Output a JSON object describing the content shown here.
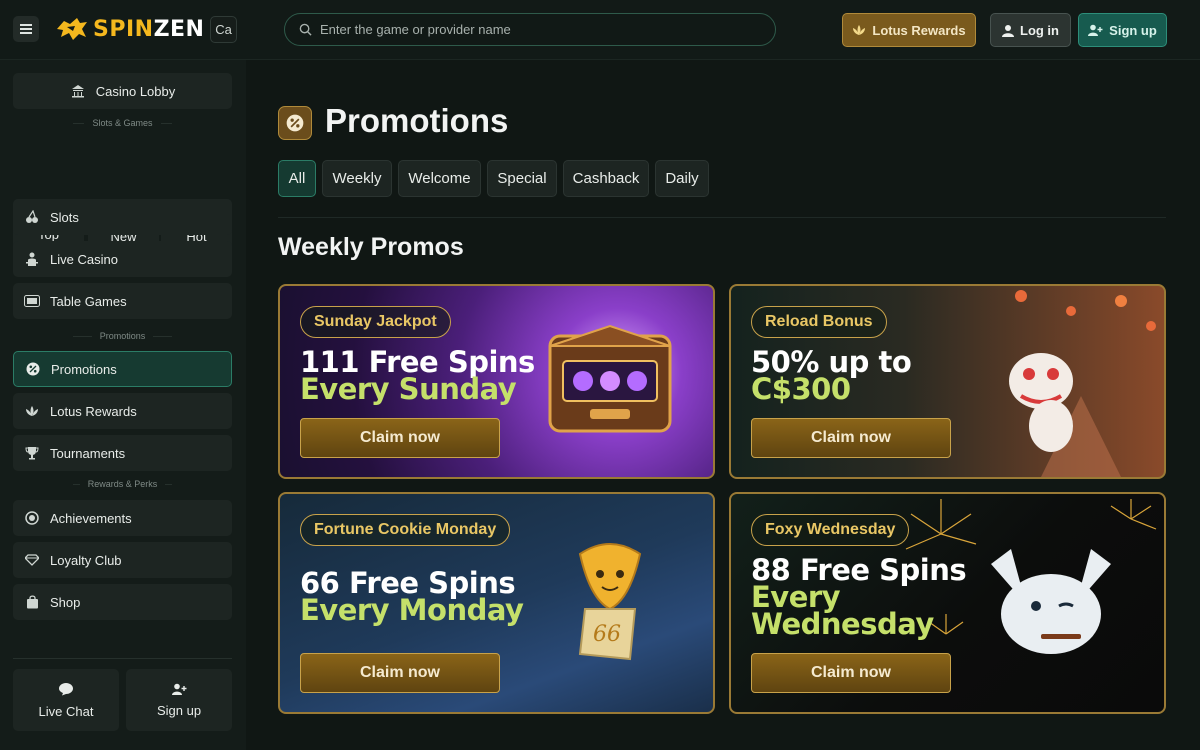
{
  "header": {
    "brand": {
      "part1": "SPIN",
      "part2": "ZEN"
    },
    "lang": "Ca",
    "search_placeholder": "Enter the game or provider name",
    "rewards_label": "Lotus Rewards",
    "login_label": "Log in",
    "signup_label": "Sign up"
  },
  "sidebar": {
    "lobby": "Casino Lobby",
    "sep1": "Slots & Games",
    "categories": [
      {
        "label": "Top",
        "icon": "crown-icon"
      },
      {
        "label": "New",
        "icon": "new-badge-icon"
      },
      {
        "label": "Hot",
        "icon": "flame-icon"
      }
    ],
    "games": [
      {
        "label": "Slots",
        "icon": "cherry-icon"
      },
      {
        "label": "Live Casino",
        "icon": "dealer-icon"
      },
      {
        "label": "Table Games",
        "icon": "table-icon"
      }
    ],
    "sep2": "Promotions",
    "promos": [
      {
        "label": "Promotions",
        "icon": "percent-icon"
      },
      {
        "label": "Lotus Rewards",
        "icon": "lotus-icon"
      },
      {
        "label": "Tournaments",
        "icon": "trophy-icon"
      }
    ],
    "sep3": "Rewards & Perks",
    "perks": [
      {
        "label": "Achievements",
        "icon": "medal-icon"
      },
      {
        "label": "Loyalty Club",
        "icon": "diamond-icon"
      },
      {
        "label": "Shop",
        "icon": "bag-icon"
      }
    ],
    "bottom": {
      "chat": "Live Chat",
      "signup": "Sign up"
    }
  },
  "main": {
    "title": "Promotions",
    "tabs": [
      "All",
      "Weekly",
      "Welcome",
      "Special",
      "Cashback",
      "Daily"
    ],
    "active_tab": "All",
    "section_title": "Weekly Promos",
    "cards": [
      {
        "badge": "Sunday Jackpot",
        "line1": "111 Free Spins",
        "line2": "Every Sunday",
        "cta": "Claim now"
      },
      {
        "badge": "Reload Bonus",
        "line1": "50% up to",
        "line2": "C$300",
        "cta": "Claim now"
      },
      {
        "badge": "Fortune Cookie Monday",
        "line1": "66 Free Spins",
        "line2": "Every Monday",
        "cta": "Claim now",
        "art_text": "66"
      },
      {
        "badge": "Foxy Wednesday",
        "line1": "88 Free Spins",
        "line2": "Every",
        "line3": "Wednesday",
        "cta": "Claim now"
      }
    ]
  },
  "colors": {
    "accent_green": "#2b7c66",
    "gold": "#c8a24a",
    "headline_green": "#c5e06a",
    "brand_yellow": "#f5b81e"
  }
}
